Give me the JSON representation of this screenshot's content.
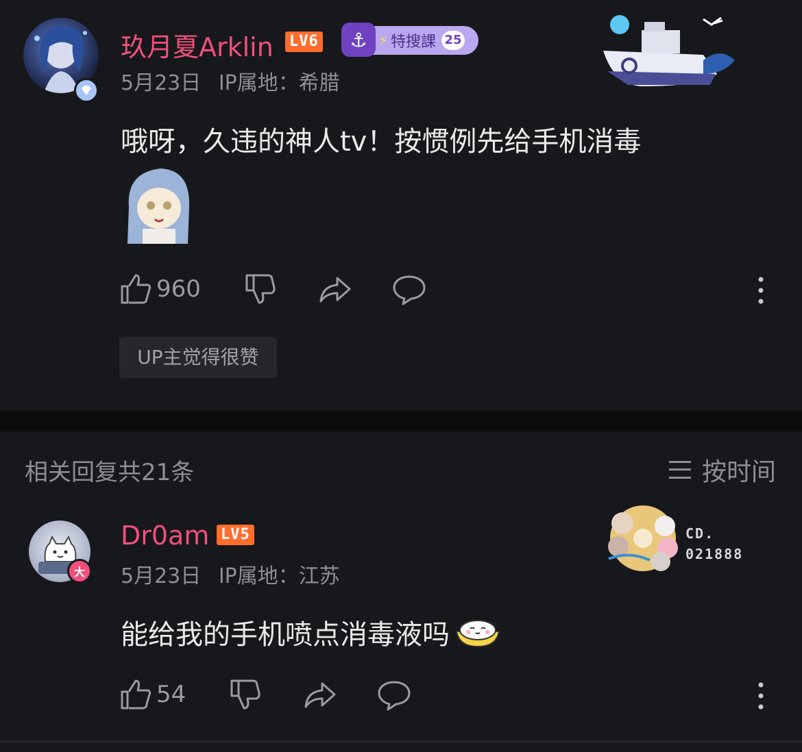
{
  "main_comment": {
    "username": "玖月夏Arklin",
    "level": "LV6",
    "fan_badge": {
      "name": "特搜課",
      "level": "25"
    },
    "date": "5月23日",
    "ip_location": "IP属地：希腊",
    "text": "哦呀，久违的神人tv！按惯例先给手机消毒",
    "likes": "960",
    "up_liked_label": "UP主觉得很赞",
    "icons": [
      "like-icon",
      "dislike-icon",
      "share-icon",
      "reply-icon",
      "more-icon"
    ]
  },
  "replies_header": {
    "count_label": "相关回复共21条",
    "sort_label": "按时间"
  },
  "reply": {
    "username": "Dr0am",
    "level": "LV5",
    "vip_mark": "大",
    "date": "5月23日",
    "ip_location": "IP属地：江苏",
    "text": "能给我的手机喷点消毒液吗",
    "likes": "54",
    "decor_text_line1": "CD.",
    "decor_text_line2": "021888"
  },
  "colors": {
    "background": "#17181b",
    "username": "#f0507c",
    "level_badge": "#ff6d2e",
    "meta": "#8d8f96"
  }
}
